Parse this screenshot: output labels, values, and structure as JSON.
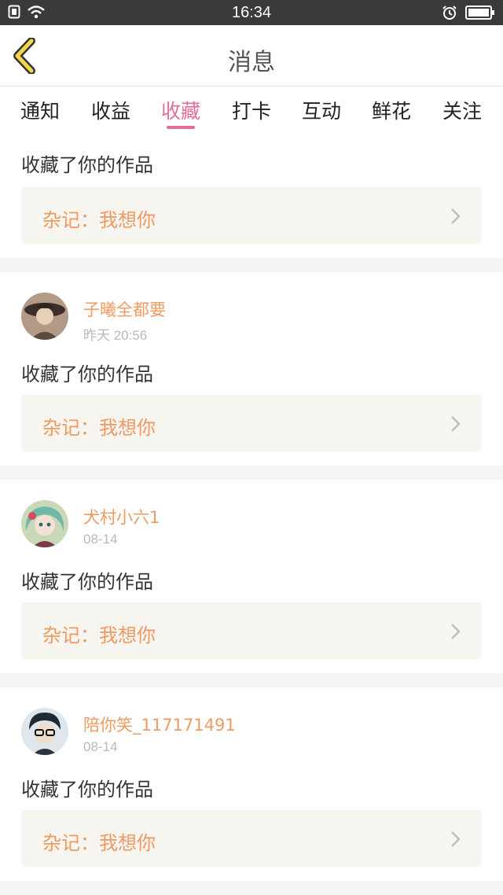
{
  "status_bar": {
    "time": "16:34"
  },
  "header": {
    "title": "消息"
  },
  "tabs": [
    {
      "label": "通知"
    },
    {
      "label": "收益"
    },
    {
      "label": "收藏"
    },
    {
      "label": "打卡"
    },
    {
      "label": "互动"
    },
    {
      "label": "鲜花"
    },
    {
      "label": "关注"
    }
  ],
  "active_tab": "收藏",
  "colors": {
    "accent": "#e46d9a",
    "orange": "#ef9a62",
    "work_bg": "#f6f5ef"
  },
  "items": [
    {
      "action": "收藏了你的作品",
      "work": "杂记：我想你"
    },
    {
      "user": "子曦全都要",
      "date": "昨天 20:56",
      "action": "收藏了你的作品",
      "work": "杂记：我想你"
    },
    {
      "user": "犬村小六1",
      "date": "08-14",
      "action": "收藏了你的作品",
      "work": "杂记：我想你"
    },
    {
      "user": "陪你笑_117171491",
      "date": "08-14",
      "action": "收藏了你的作品",
      "work": "杂记：我想你"
    }
  ]
}
